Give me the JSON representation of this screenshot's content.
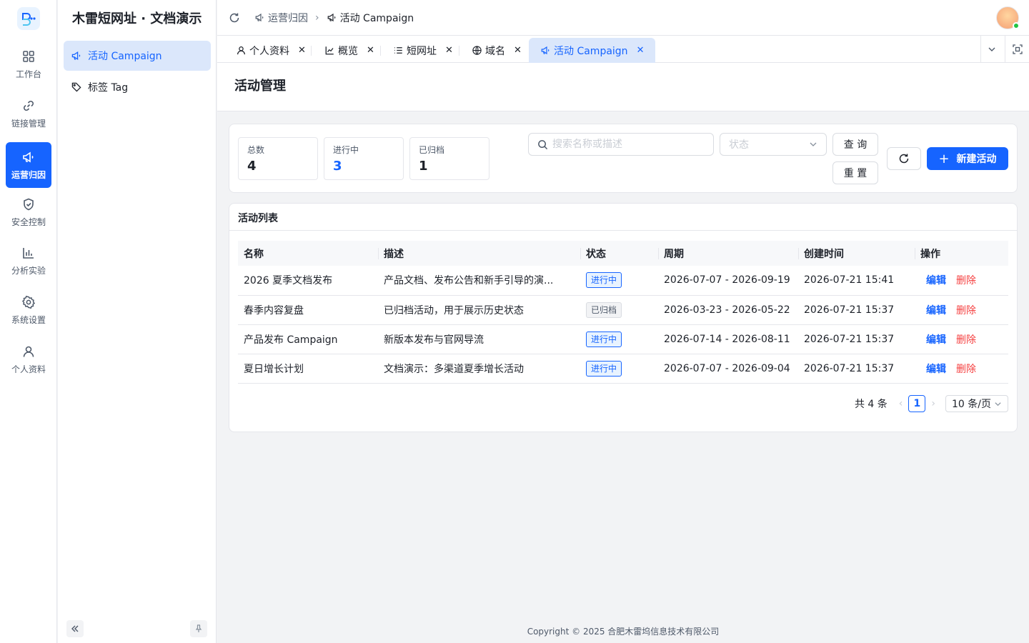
{
  "brand": {
    "title": "木雷短网址 · 文档演示"
  },
  "rail": [
    {
      "label": "工作台",
      "icon": "dashboard-icon"
    },
    {
      "label": "链接管理",
      "icon": "link-icon"
    },
    {
      "label": "运营归因",
      "icon": "megaphone-icon",
      "active": true
    },
    {
      "label": "安全控制",
      "icon": "shield-icon"
    },
    {
      "label": "分析实验",
      "icon": "bar-chart-icon"
    },
    {
      "label": "系统设置",
      "icon": "gear-icon"
    },
    {
      "label": "个人资料",
      "icon": "user-icon"
    }
  ],
  "submenu": [
    {
      "label": "活动 Campaign",
      "icon": "megaphone-icon",
      "active": true
    },
    {
      "label": "标签 Tag",
      "icon": "tag-icon"
    }
  ],
  "breadcrumb": {
    "parent": "运营归因",
    "current": "活动 Campaign"
  },
  "tabs": [
    {
      "label": "个人资料",
      "icon": "user-icon"
    },
    {
      "label": "概览",
      "icon": "chart-icon"
    },
    {
      "label": "短网址",
      "icon": "list-icon"
    },
    {
      "label": "域名",
      "icon": "globe-icon"
    },
    {
      "label": "活动 Campaign",
      "icon": "megaphone-icon",
      "active": true
    }
  ],
  "page": {
    "title": "活动管理"
  },
  "stats": [
    {
      "label": "总数",
      "value": "4"
    },
    {
      "label": "进行中",
      "value": "3"
    },
    {
      "label": "已归档",
      "value": "1"
    }
  ],
  "filters": {
    "search_placeholder": "搜索名称或描述",
    "status_placeholder": "状态",
    "query_label": "查 询",
    "reset_label": "重 置",
    "new_label": "新建活动"
  },
  "list": {
    "title": "活动列表",
    "columns": [
      "名称",
      "描述",
      "状态",
      "周期",
      "创建时间",
      "操作"
    ],
    "rows": [
      {
        "name": "2026 夏季文档发布",
        "desc": "产品文档、发布公告和新手引导的演...",
        "status": "进行中",
        "status_type": "active",
        "period": "2026-07-07 - 2026-09-19",
        "created": "2026-07-21 15:41",
        "edit": "编辑",
        "delete": "删除"
      },
      {
        "name": "春季内容复盘",
        "desc": "已归档活动，用于展示历史状态",
        "status": "已归档",
        "status_type": "archived",
        "period": "2026-03-23 - 2026-05-22",
        "created": "2026-07-21 15:37",
        "edit": "编辑",
        "delete": "删除"
      },
      {
        "name": "产品发布 Campaign",
        "desc": "新版本发布与官网导流",
        "status": "进行中",
        "status_type": "active",
        "period": "2026-07-14 - 2026-08-11",
        "created": "2026-07-21 15:37",
        "edit": "编辑",
        "delete": "删除"
      },
      {
        "name": "夏日增长计划",
        "desc": "文档演示：多渠道夏季增长活动",
        "status": "进行中",
        "status_type": "active",
        "period": "2026-07-07 - 2026-09-04",
        "created": "2026-07-21 15:37",
        "edit": "编辑",
        "delete": "删除"
      }
    ]
  },
  "pagination": {
    "total": "共 4 条",
    "current": "1",
    "page_size": "10 条/页"
  },
  "footer": {
    "copyright": "Copyright © 2025 合肥木雷坞信息技术有限公司"
  },
  "colors": {
    "primary": "#1664ff",
    "danger": "#f53f3f",
    "success": "#23c343"
  }
}
